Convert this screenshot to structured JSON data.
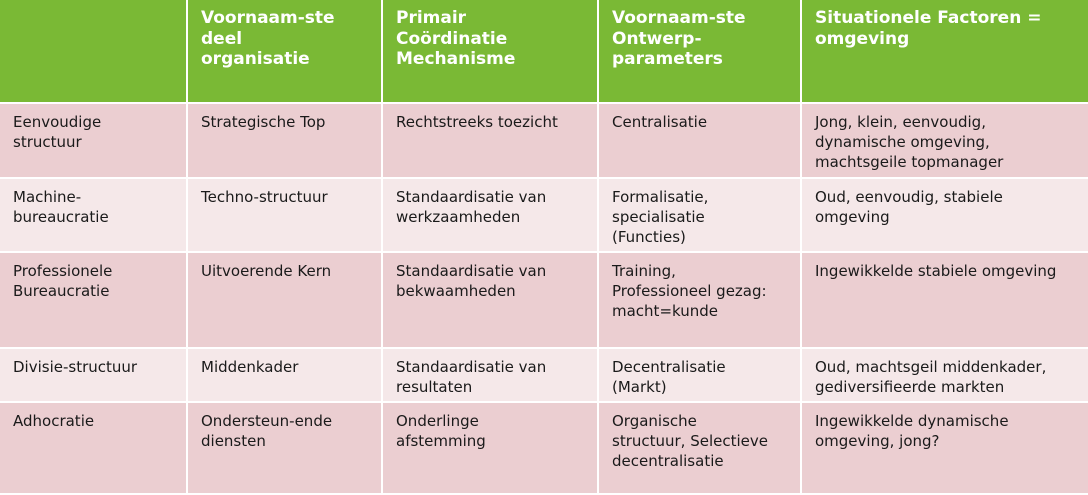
{
  "table": {
    "headers": [
      "",
      "Voornaam-ste\ndeel\norganisatie",
      "Primair\nCoördinatie\nMechanisme",
      "Voornaam-ste\nOntwerp-\nparameters",
      "Situationele Factoren =\nomgeving"
    ],
    "rows": [
      [
        "Eenvoudige\nstructuur",
        "Strategische Top",
        "Rechtstreeks toezicht",
        "Centralisatie",
        "Jong, klein, eenvoudig,\ndynamische omgeving,\nmachtsgeile topmanager"
      ],
      [
        "Machine-\nbureaucratie",
        "Techno-structuur",
        "Standaardisatie van\nwerkzaamheden",
        "Formalisatie,\nspecialisatie\n(Functies)",
        "Oud, eenvoudig, stabiele\nomgeving"
      ],
      [
        "Professionele\nBureaucratie",
        "Uitvoerende Kern",
        "Standaardisatie van\nbekwaamheden",
        "Training,\nProfessioneel gezag:\nmacht=kunde",
        "Ingewikkelde stabiele omgeving"
      ],
      [
        "Divisie-structuur",
        "Middenkader",
        "Standaardisatie van\nresultaten",
        "Decentralisatie\n(Markt)",
        "Oud, machtsgeil middenkader,\ngediversifieerde markten"
      ],
      [
        "Adhocratie",
        "Ondersteun-ende\ndiensten",
        "Onderlinge\nafstemming",
        "Organische\nstructuur, Selectieve\ndecentralisatie",
        "Ingewikkelde dynamische\nomgeving, jong?"
      ]
    ]
  },
  "colors": {
    "header_bg": "#7ab935",
    "header_text": "#ffffff",
    "row_odd_bg": "#ebced1",
    "row_even_bg": "#f5e8e9"
  }
}
